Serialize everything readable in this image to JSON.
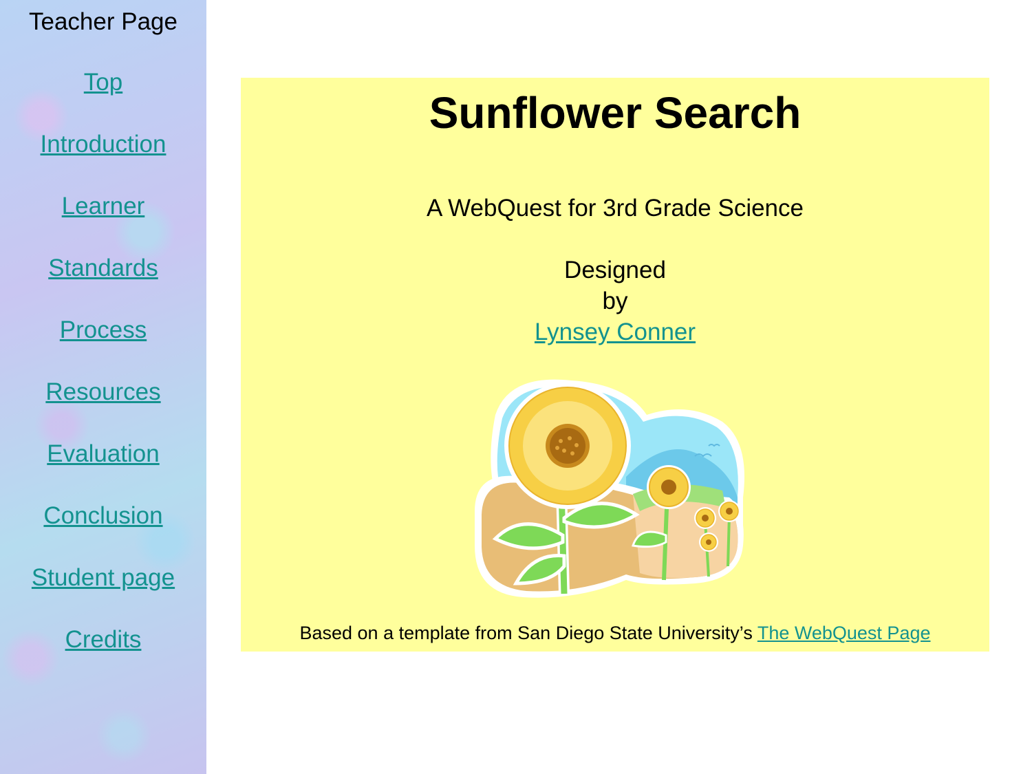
{
  "sidebar": {
    "heading": "Teacher Page",
    "links": [
      "Top",
      "Introduction",
      "Learner",
      "Standards",
      "Process",
      "Resources",
      "Evaluation",
      "Conclusion",
      "Student page",
      "Credits"
    ]
  },
  "main": {
    "title": "Sunflower Search",
    "subtitle": "A WebQuest for 3rd Grade Science",
    "designed": "Designed",
    "by": "by",
    "author": "Lynsey Conner",
    "footer_text": "Based on a template from San Diego State University’s ",
    "footer_link": "The WebQuest Page"
  },
  "colors": {
    "panel": "#ffff9c",
    "link": "#13928f"
  }
}
